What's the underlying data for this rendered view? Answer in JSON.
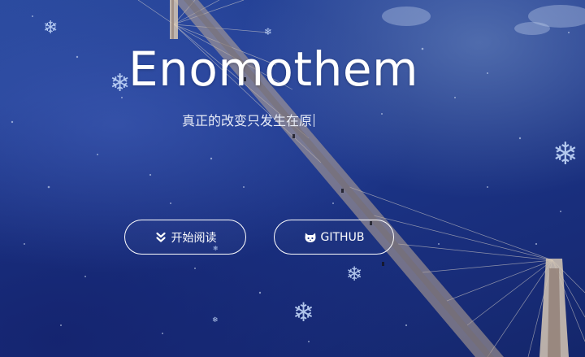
{
  "hero": {
    "title": "Enomothem",
    "subtitle": "真正的改变只发生在原"
  },
  "buttons": {
    "read_label": "开始阅读",
    "github_label": "GITHUB"
  },
  "icons": {
    "read": "double-chevron-down-icon",
    "github": "github-cat-icon",
    "decor": "snowflake-icon"
  },
  "colors": {
    "background": "#1b3385",
    "text": "#ffffff"
  }
}
